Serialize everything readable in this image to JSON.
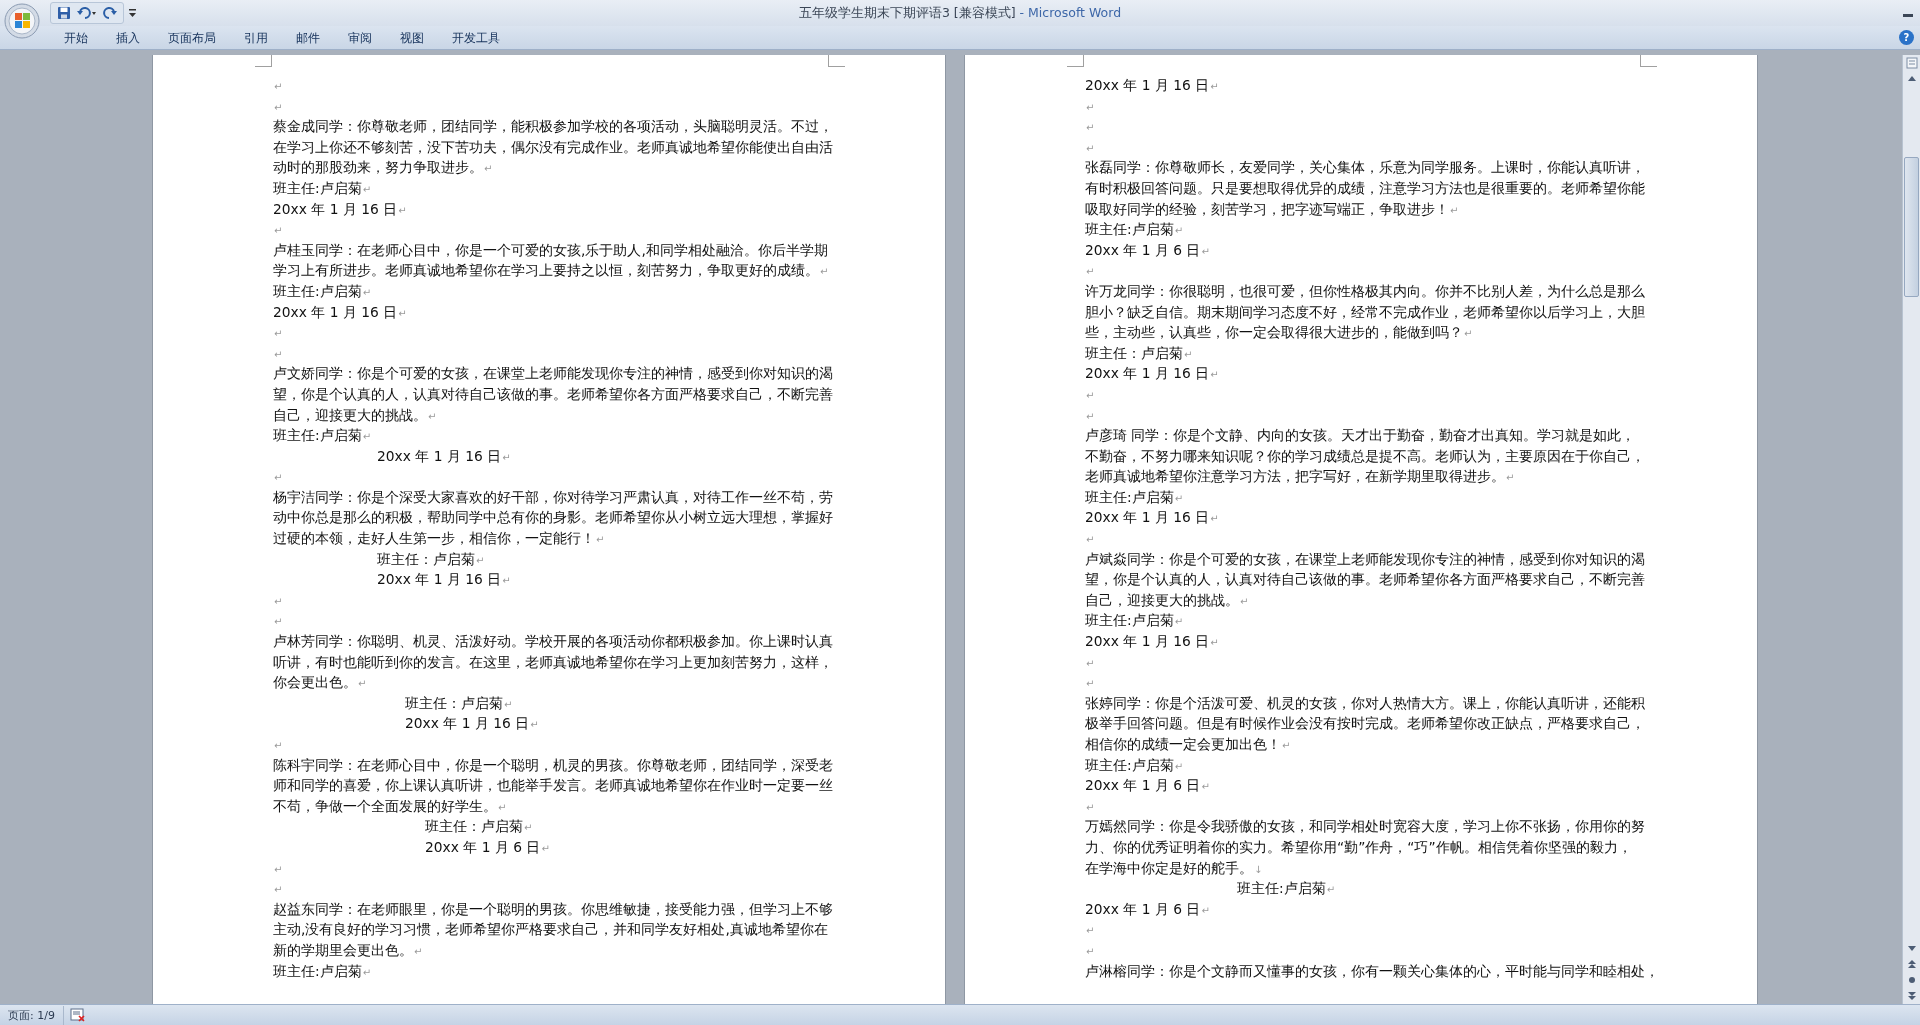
{
  "window": {
    "title": "五年级学生期末下期评语3 [兼容模式]",
    "app": "- Microsoft Word"
  },
  "ribbon_tabs": [
    {
      "label": "开始"
    },
    {
      "label": "插入"
    },
    {
      "label": "页面布局"
    },
    {
      "label": "引用"
    },
    {
      "label": "邮件"
    },
    {
      "label": "审阅"
    },
    {
      "label": "视图"
    },
    {
      "label": "开发工具"
    }
  ],
  "help": "?",
  "pages": [
    {
      "lines": [
        {
          "kind": "blank",
          "mark": "↵"
        },
        {
          "kind": "blank",
          "mark": "↵"
        },
        {
          "kind": "comment",
          "text": "蔡金成同学：你尊敬老师，团结同学，能积极参加学校的各项活动，头脑聪明灵活。不过，在学习上你还不够刻苦，没下苦功夫，偶尔没有完成作业。老师真诚地希望你能使出自由活动时的那股劲来，努力争取进步。",
          "mark": "↵"
        },
        {
          "kind": "signature",
          "text": "班主任:卢启菊",
          "mark": "↵"
        },
        {
          "kind": "date",
          "text": "20xx 年 1 月 16 日",
          "mark": "↵"
        },
        {
          "kind": "blank",
          "mark": "↵"
        },
        {
          "kind": "comment",
          "text": "卢桂玉同学：在老师心目中，你是一个可爱的女孩,乐于助人,和同学相处融洽。你后半学期学习上有所进步。老师真诚地希望你在学习上要持之以恒，刻苦努力，争取更好的成绩。",
          "mark": "↵"
        },
        {
          "kind": "signature",
          "text": "班主任:卢启菊",
          "mark": "↵"
        },
        {
          "kind": "date",
          "text": "20xx 年 1 月 16 日",
          "mark": "↵"
        },
        {
          "kind": "blank",
          "mark": "↵"
        },
        {
          "kind": "blank",
          "mark": "↵"
        },
        {
          "kind": "comment",
          "text": "卢文娇同学：你是个可爱的女孩，在课堂上老师能发现你专注的神情，感受到你对知识的渴望，你是个认真的人，认真对待自己该做的事。老师希望你各方面严格要求自己，不断完善自己，迎接更大的挑战。",
          "mark": "↵"
        },
        {
          "kind": "signature",
          "text": "班主任:卢启菊",
          "mark": "↵"
        },
        {
          "kind": "date-medium",
          "text": "20xx 年 1 月 16 日",
          "mark": "↵"
        },
        {
          "kind": "blank",
          "mark": "↵"
        },
        {
          "kind": "comment",
          "text": "杨宇洁同学：你是个深受大家喜欢的好干部，你对待学习严肃认真，对待工作一丝不苟，劳动中你总是那么的积极，帮助同学中总有你的身影。老师希望你从小树立远大理想，掌握好过硬的本领，走好人生第一步，相信你，一定能行！",
          "mark": "↵"
        },
        {
          "kind": "signature-medium",
          "text": "班主任：卢启菊",
          "mark": "↵"
        },
        {
          "kind": "date-medium",
          "text": "20xx 年 1 月 16 日",
          "mark": "↵"
        },
        {
          "kind": "blank",
          "mark": "↵"
        },
        {
          "kind": "blank",
          "mark": "↵"
        },
        {
          "kind": "comment",
          "text": "卢林芳同学：你聪明、机灵、活泼好动。学校开展的各项活动你都积极参加。你上课时认真听讲，有时也能听到你的发言。在这里，老师真诚地希望你在学习上更加刻苦努力，这样，你会更出色。",
          "mark": "↵"
        },
        {
          "kind": "signature-wide",
          "text": "班主任：卢启菊",
          "mark": "↵"
        },
        {
          "kind": "date-wide",
          "text": "20xx 年 1 月 16 日",
          "mark": "↵"
        },
        {
          "kind": "blank",
          "mark": "↵"
        },
        {
          "kind": "comment",
          "text": "陈科宇同学：在老师心目中，你是一个聪明，机灵的男孩。你尊敬老师，团结同学，深受老师和同学的喜爱，你上课认真听讲，也能举手发言。老师真诚地希望你在作业时一定要一丝不苟，争做一个全面发展的好学生。",
          "mark": "↵"
        },
        {
          "kind": "signature-wider",
          "text": "班主任：卢启菊",
          "mark": "↵"
        },
        {
          "kind": "date-wider",
          "text": "20xx 年 1 月 6 日",
          "mark": "↵"
        },
        {
          "kind": "blank",
          "mark": "↵"
        },
        {
          "kind": "blank",
          "mark": "↵"
        },
        {
          "kind": "comment",
          "text": "赵益东同学：在老师眼里，你是一个聪明的男孩。你思维敏捷，接受能力强，但学习上不够主动,没有良好的学习习惯，老师希望你严格要求自己，并和同学友好相处,真诚地希望你在新的学期里会更出色。",
          "mark": "↵"
        },
        {
          "kind": "signature",
          "text": "班主任:卢启菊",
          "mark": "↵"
        }
      ]
    },
    {
      "lines": [
        {
          "kind": "date",
          "text": "20xx 年 1 月 16 日",
          "mark": "↵"
        },
        {
          "kind": "blank",
          "mark": "↵"
        },
        {
          "kind": "blank",
          "mark": "↵"
        },
        {
          "kind": "blank",
          "mark": "↵"
        },
        {
          "kind": "comment",
          "text": "张磊同学：你尊敬师长，友爱同学，关心集体，乐意为同学服务。上课时，你能认真听讲，有时积极回答问题。只是要想取得优异的成绩，注意学习方法也是很重要的。老师希望你能吸取好同学的经验，刻苦学习，把字迹写端正，争取进步！",
          "mark": "↵"
        },
        {
          "kind": "signature",
          "text": "班主任:卢启菊",
          "mark": "↵"
        },
        {
          "kind": "date",
          "text": "20xx 年 1 月 6 日",
          "mark": "↵"
        },
        {
          "kind": "blank",
          "mark": "↵"
        },
        {
          "kind": "comment",
          "text": "许万龙同学：你很聪明，也很可爱，但你性格极其内向。你并不比别人差，为什么总是那么胆小？缺乏自信。期末期间学习态度不好，经常不完成作业，老师希望你以后学习上，大胆些，主动些，认真些，你一定会取得很大进步的，能做到吗？",
          "mark": "↵"
        },
        {
          "kind": "signature",
          "text": "班主任：卢启菊",
          "mark": "↵"
        },
        {
          "kind": "date",
          "text": "20xx 年 1 月 16 日",
          "mark": "↵"
        },
        {
          "kind": "blank",
          "mark": "↵"
        },
        {
          "kind": "blank",
          "mark": "↵"
        },
        {
          "kind": "comment",
          "text": "卢彦琦 同学：你是个文静、内向的女孩。天才出于勤奋，勤奋才出真知。学习就是如此，不勤奋，不努力哪来知识呢？你的学习成绩总是提不高。老师认为，主要原因在于你自己，老师真诚地希望你注意学习方法，把字写好，在新学期里取得进步。",
          "mark": "↵"
        },
        {
          "kind": "signature",
          "text": "班主任:卢启菊",
          "mark": "↵"
        },
        {
          "kind": "date",
          "text": "20xx 年 1 月 16 日",
          "mark": "↵"
        },
        {
          "kind": "blank",
          "mark": "↵"
        },
        {
          "kind": "comment",
          "text": "卢斌焱同学：你是个可爱的女孩，在课堂上老师能发现你专注的神情，感受到你对知识的渴望，你是个认真的人，认真对待自己该做的事。老师希望你各方面严格要求自己，不断完善自己，迎接更大的挑战。",
          "mark": "↵"
        },
        {
          "kind": "signature",
          "text": "班主任:卢启菊",
          "mark": "↵"
        },
        {
          "kind": "date",
          "text": "20xx 年 1 月 16 日",
          "mark": "↵"
        },
        {
          "kind": "blank",
          "mark": "↵"
        },
        {
          "kind": "blank",
          "mark": "↵"
        },
        {
          "kind": "comment",
          "text": "张婷同学：你是个活泼可爱、机灵的女孩，你对人热情大方。课上，你能认真听讲，还能积极举手回答问题。但是有时候作业会没有按时完成。老师希望你改正缺点，严格要求自己，相信你的成绩一定会更加出色！",
          "mark": "↵"
        },
        {
          "kind": "signature",
          "text": "班主任:卢启菊",
          "mark": "↵"
        },
        {
          "kind": "date",
          "text": "20xx 年 1 月 6 日",
          "mark": "↵"
        },
        {
          "kind": "blank",
          "mark": "↵"
        },
        {
          "kind": "comment",
          "text": "万嫣然同学：你是令我骄傲的女孩，和同学相处时宽容大度，学习上你不张扬，你用你的努力、你的优秀证明着你的实力。希望你用“勤”作舟，“巧”作帆。相信凭着你坚强的毅力，在学海中你定是好的舵手。",
          "mark": "↓"
        },
        {
          "kind": "signature-wider",
          "text": "班主任:卢启菊",
          "mark": "↵"
        },
        {
          "kind": "date",
          "text": "20xx 年 1 月 6 日",
          "mark": "↵"
        },
        {
          "kind": "blank",
          "mark": "↵"
        },
        {
          "kind": "blank",
          "mark": "↵"
        },
        {
          "kind": "comment",
          "text": "卢淋榕同学：你是个文静而又懂事的女孩，你有一颗关心集体的心，平时能与同学和睦相处，"
        }
      ]
    }
  ],
  "status_bar": {
    "page": "页面: 1/9"
  }
}
